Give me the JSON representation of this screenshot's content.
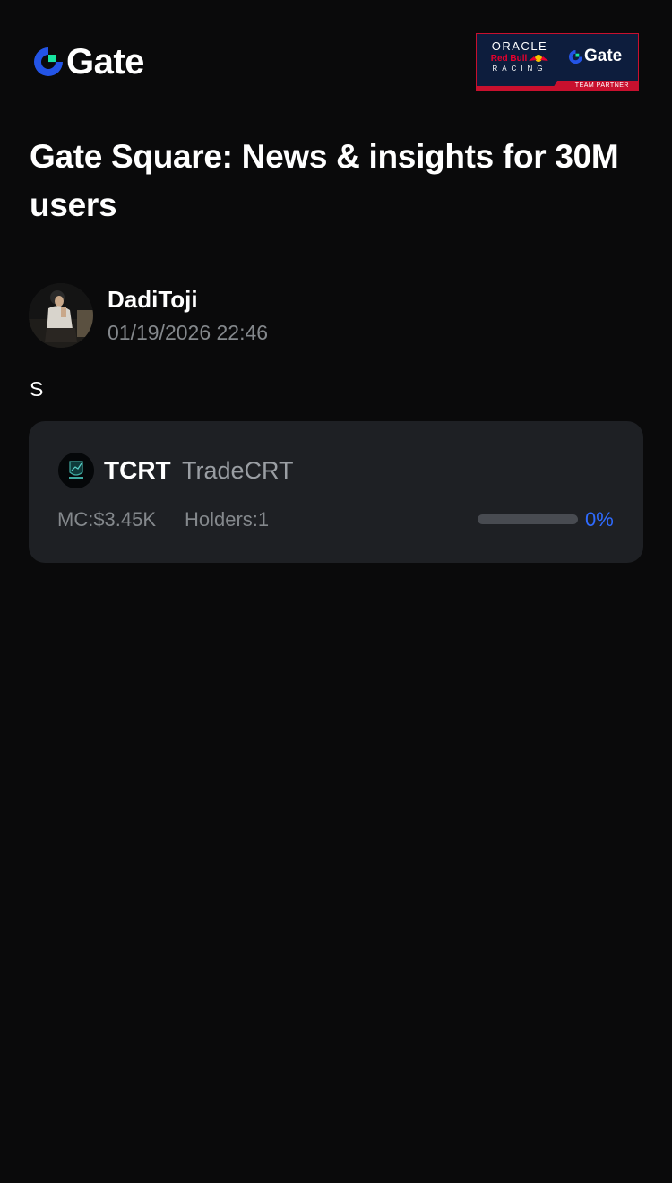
{
  "header": {
    "logo_text": "Gate",
    "partner_badge": {
      "line1": "ORACLE",
      "line2": "Red Bull",
      "line3": "RACING",
      "brand": "Gate",
      "caption": "TEAM PARTNER"
    }
  },
  "page": {
    "title": "Gate Square: News & insights for 30M users"
  },
  "post": {
    "author": "DadiToji",
    "timestamp": "01/19/2026 22:46",
    "body": "S"
  },
  "token_card": {
    "symbol": "TCRT",
    "name": "TradeCRT",
    "market_cap": "MC:$3.45K",
    "holders": "Holders:1",
    "progress_label": "0%",
    "progress_value": 0
  },
  "colors": {
    "background": "#0a0a0b",
    "card": "#1e2024",
    "accent_blue": "#2f6bff",
    "brand_green": "#17e5a0",
    "muted_text": "#84888c",
    "partner_red": "#c8102e",
    "partner_navy": "#0d1d3d"
  },
  "icons": {
    "logo": "gate-logo-icon",
    "avatar": "user-avatar",
    "token": "tradecrt-token-icon"
  }
}
